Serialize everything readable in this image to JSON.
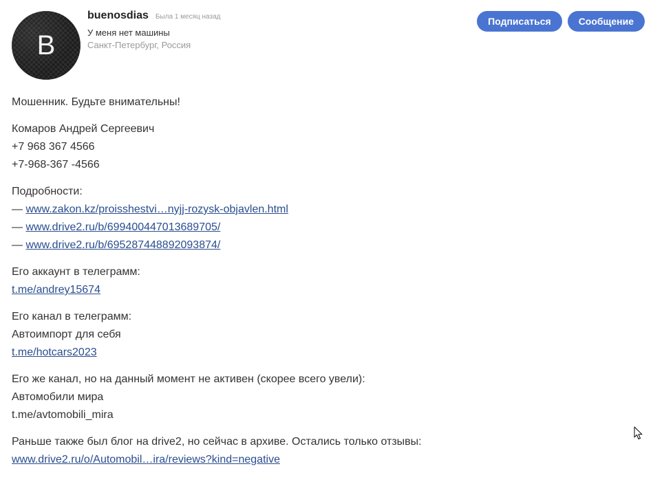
{
  "profile": {
    "avatar_letter": "B",
    "username": "buenosdias",
    "last_seen": "Была 1 месяц назад",
    "car_status": "У меня нет машины",
    "location": "Санкт-Петербург, Россия"
  },
  "actions": {
    "subscribe_label": "Подписаться",
    "message_label": "Сообщение"
  },
  "post": {
    "warning": "Мошенник. Будьте внимательны!",
    "person": {
      "name": "Комаров Андрей Сергеевич",
      "phone1": "+7 968 367 4566",
      "phone2": "+7-968-367 -4566"
    },
    "details": {
      "heading": "Подробности:",
      "dash": "— ",
      "links": [
        "www.zakon.kz/proisshestvi…nyjj-rozysk-objavlen.html",
        "www.drive2.ru/b/699400447013689705/",
        "www.drive2.ru/b/695287448892093874/"
      ]
    },
    "telegram_account": {
      "label": "Его аккаунт в телеграмм:",
      "link": "t.me/andrey15674"
    },
    "telegram_channel": {
      "label": "Его канал в телеграмм:",
      "name": "Автоимпорт для себя",
      "link": "t.me/hotcars2023"
    },
    "inactive_channel": {
      "label": "Его же канал, но на данный момент не активен (скорее всего увели):",
      "name": "Автомобили мира",
      "handle": "t.me/avtomobili_mira"
    },
    "blog": {
      "label": "Раньше также был блог на drive2, но сейчас в архиве. Остались только отзывы:",
      "link": "www.drive2.ru/o/Automobil…ira/reviews?kind=negative"
    }
  },
  "colors": {
    "accent": "#4a74d1",
    "link": "#2a4d8f",
    "text": "#333333",
    "muted": "#999999"
  },
  "icons": {
    "cursor": "mouse-pointer-icon"
  }
}
